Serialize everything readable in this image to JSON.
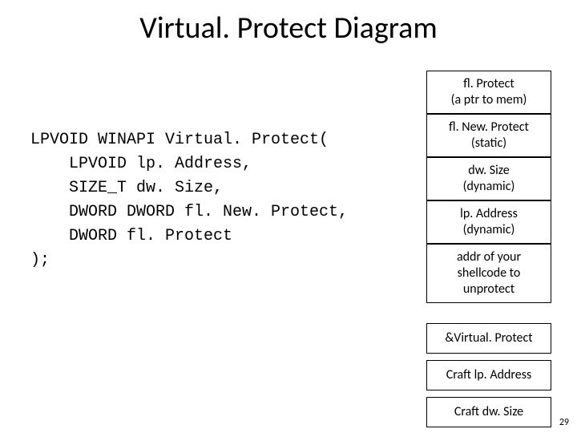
{
  "title": "Virtual. Protect Diagram",
  "code": {
    "line1": "LPVOID WINAPI Virtual. Protect(",
    "line2": "    LPVOID lp. Address,",
    "line3": "    SIZE_T dw. Size,",
    "line4": "    DWORD DWORD fl. New. Protect,",
    "line5": "    DWORD fl. Protect",
    "line6": ");"
  },
  "stack": [
    {
      "l1": "fl. Protect",
      "l2": "(a ptr to mem)"
    },
    {
      "l1": "fl. New. Protect",
      "l2": "(static)"
    },
    {
      "l1": "dw. Size",
      "l2": "(dynamic)"
    },
    {
      "l1": "lp. Address",
      "l2": "(dynamic)"
    },
    {
      "l1": "addr of your",
      "l2": "shellcode to",
      "l3": "unprotect"
    }
  ],
  "steps": [
    "&Virtual. Protect",
    "Craft lp. Address",
    "Craft dw. Size"
  ],
  "page_number": "29"
}
